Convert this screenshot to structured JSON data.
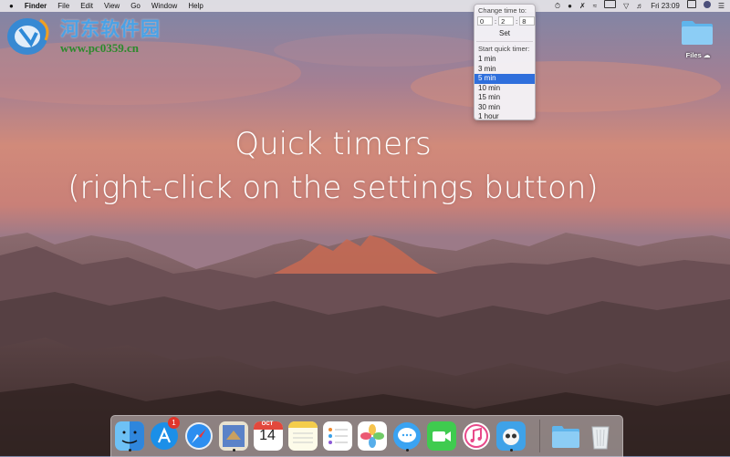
{
  "menubar": {
    "apple": "",
    "app_name": "Finder",
    "menus": [
      "File",
      "Edit",
      "View",
      "Go",
      "Window",
      "Help"
    ],
    "clock": "Fri 23:09"
  },
  "watermark": {
    "site_name": "河东软件园",
    "url": "www.pc0359.cn"
  },
  "timer_popup": {
    "change_label": "Change time to:",
    "fields": [
      "0",
      "2",
      "8"
    ],
    "set_label": "Set",
    "quick_label": "Start quick timer:",
    "options": [
      "1 min",
      "3 min",
      "5 min",
      "10 min",
      "15 min",
      "30 min",
      "1 hour"
    ],
    "selected_index": 2
  },
  "caption": {
    "line1": "Quick timers",
    "line2": "(right-click on the settings button)"
  },
  "desktop": {
    "folder_label": "Files"
  },
  "dock": {
    "apps": [
      "finder-icon",
      "app-store-icon",
      "safari-icon",
      "mail-icon",
      "calendar-icon",
      "notes-icon",
      "reminders-icon",
      "photos-icon",
      "messages-icon",
      "facetime-icon",
      "itunes-icon",
      "tweetbot-icon",
      "folder-icon",
      "trash-icon"
    ],
    "app_store_badge": "1",
    "calendar_month": "OCT",
    "calendar_day": "14"
  },
  "colors": {
    "selection": "#2f6fdc",
    "badge": "#e0352b",
    "watermark_cn": "#4aa2e6",
    "watermark_url": "#2b8a2b"
  }
}
